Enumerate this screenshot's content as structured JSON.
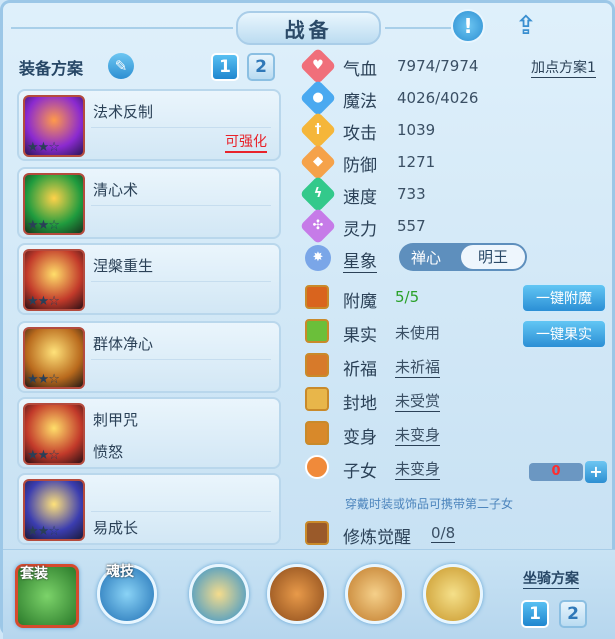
{
  "header": {
    "title": "战备"
  },
  "left_panel": {
    "scheme_title": "装备方案",
    "scheme_tabs": [
      "1",
      "2"
    ],
    "cards": [
      {
        "name": "法术反制",
        "stars": "★★☆",
        "tag": "可强化"
      },
      {
        "name": "清心术",
        "stars": "★★☆"
      },
      {
        "name": "涅槃重生",
        "stars": "★★☆"
      },
      {
        "name": "群体净心",
        "stars": "★★☆"
      },
      {
        "name": "刺甲咒",
        "sub": "愤怒",
        "stars": "★★☆"
      },
      {
        "name": "易成长",
        "stars": "★★☆"
      }
    ]
  },
  "stats": {
    "add_point_scheme": "加点方案1",
    "items": [
      {
        "label": "气血",
        "value": "7974/7974",
        "color": "#f06f7a",
        "icon": "heart-icon"
      },
      {
        "label": "魔法",
        "value": "4026/4026",
        "color": "#4aa9f0",
        "icon": "mana-icon"
      },
      {
        "label": "攻击",
        "value": "1039",
        "color": "#f5b63a",
        "icon": "sword-icon"
      },
      {
        "label": "防御",
        "value": "1271",
        "color": "#f5a24a",
        "icon": "shield-icon"
      },
      {
        "label": "速度",
        "value": "733",
        "color": "#33c98b",
        "icon": "speed-icon"
      },
      {
        "label": "灵力",
        "value": "557",
        "color": "#c67be8",
        "icon": "spirit-icon"
      }
    ],
    "star_label": "星象",
    "star_options": [
      "禅心",
      "明王"
    ]
  },
  "abilities": {
    "items": [
      {
        "label": "附魔",
        "value": "5/5"
      },
      {
        "label": "果实",
        "value": "未使用"
      },
      {
        "label": "祈福",
        "value": "未祈福"
      },
      {
        "label": "封地",
        "value": "未受赏"
      },
      {
        "label": "变身",
        "value": "未变身"
      },
      {
        "label": "子女",
        "value": "未变身"
      }
    ],
    "btn_enchant": "一键附魔",
    "btn_fruit": "一键果实",
    "child_count": "0",
    "child_plus": "+",
    "note": "穿戴时装或饰品可携带第二子女",
    "cultivate_label": "修炼觉醒",
    "cultivate_value": "0/8"
  },
  "bottom": {
    "suit_tag": "套装",
    "soul_tag": "魂技",
    "mount_title": "坐骑方案",
    "mount_tabs": [
      "1",
      "2"
    ]
  }
}
